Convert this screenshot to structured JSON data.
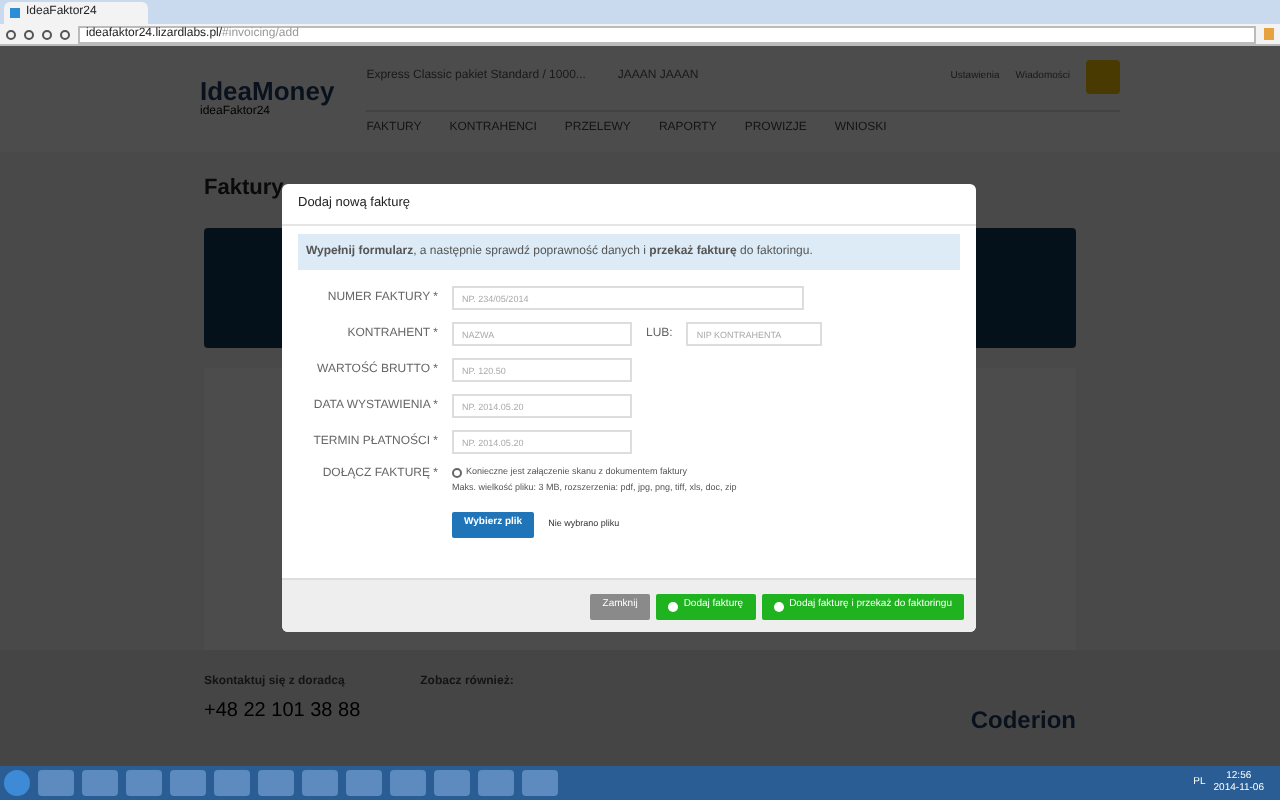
{
  "browser": {
    "tab_title": "IdeaFaktor24",
    "url_host": "ideafaktor24.lizardlabs.pl/",
    "url_path": "#invoicing/add"
  },
  "header": {
    "logo": "IdeaMoney",
    "sublogo": "ideaFaktor24",
    "package": "Express Classic pakiet Standard / 1000...",
    "user": "JAAAN JAAAN",
    "links": [
      "Ustawienia",
      "Wiadomości"
    ],
    "nav": [
      {
        "label": "FAKTURY"
      },
      {
        "label": "KONTRAHENCI"
      },
      {
        "label": "PRZELEWY"
      },
      {
        "label": "RAPORTY"
      },
      {
        "label": "PROWIZJE"
      },
      {
        "label": "WNIOSKI"
      }
    ]
  },
  "page": {
    "heading": "Faktury",
    "footer_contact": "Skontaktuj się z doradcą",
    "footer_phone": "+48 22 101 38 88",
    "footer_see": "Zobacz również:",
    "footer_brand": "Coderion"
  },
  "modal": {
    "title": "Dodaj nową fakturę",
    "intro": "**Wypełnij formularz**, a następnie sprawdź poprawność danych i **przekaż fakturę** do faktoringu.",
    "fields": [
      {
        "kind": "wide",
        "label": "NUMER FAKTURY *",
        "placeholder": "NP. 234/05/2014"
      },
      {
        "kind": "pair",
        "label": "KONTRAHENT *",
        "placeholder": "NAZWA",
        "or_label": "LUB:",
        "placeholder_2": "NIP KONTRAHENTA"
      },
      {
        "kind": "short",
        "label": "WARTOŚĆ BRUTTO *",
        "placeholder": "NP. 120.50"
      },
      {
        "kind": "short",
        "label": "DATA WYSTAWIENIA *",
        "placeholder": "NP. 2014.05.20"
      },
      {
        "kind": "short",
        "label": "TERMIN PŁATNOŚCI *",
        "placeholder": "NP. 2014.05.20"
      },
      {
        "kind": "file",
        "label": "DOŁĄCZ FAKTURĘ *",
        "info": "Konieczne jest załączenie skanu z dokumentem faktury",
        "limits": "Maks. wielkość pliku: 3 MB, rozszerzenia: pdf, jpg, png, tiff, xls, doc, zip",
        "button": "Wybierz plik",
        "status": "Nie wybrano pliku"
      }
    ],
    "buttons": [
      {
        "kind": "secondary",
        "label": "Zamknij"
      },
      {
        "kind": "primary",
        "label": "Dodaj fakturę"
      },
      {
        "kind": "primary",
        "label": "Dodaj fakturę i przekaż do faktoringu"
      }
    ]
  },
  "taskbar": {
    "language": "PL",
    "time": "12:56",
    "date": "2014-11-06"
  }
}
